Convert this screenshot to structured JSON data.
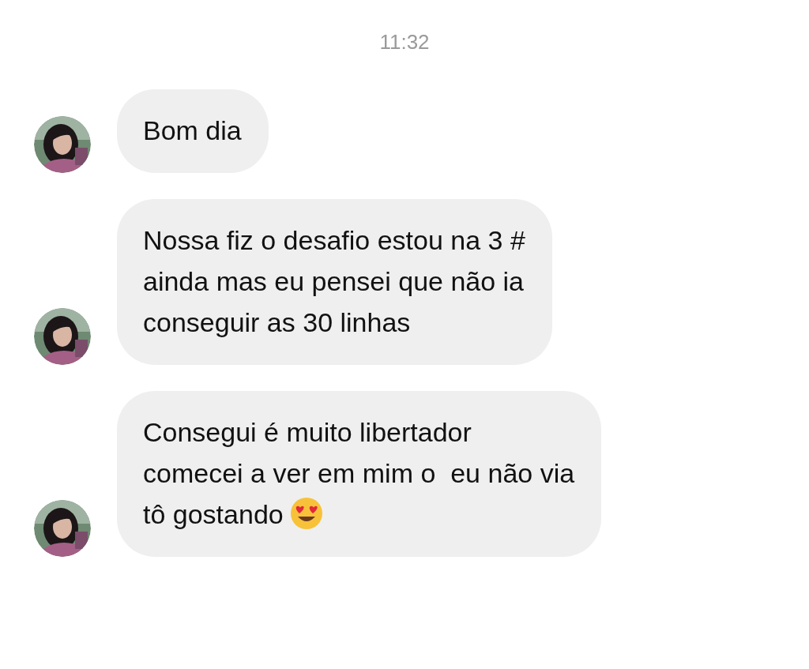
{
  "timestamp": "11:32",
  "messages": [
    {
      "kind": "text",
      "text": "Bom dia"
    },
    {
      "kind": "text",
      "text": "Nossa fiz o desafio estou na 3 #\nainda mas eu pensei que não ia\nconseguir as 30 linhas"
    },
    {
      "kind": "text_with_emoji",
      "text": "Consegui é muito libertador\ncomecei a ver em mim o  eu não via\ntô gostando"
    }
  ]
}
